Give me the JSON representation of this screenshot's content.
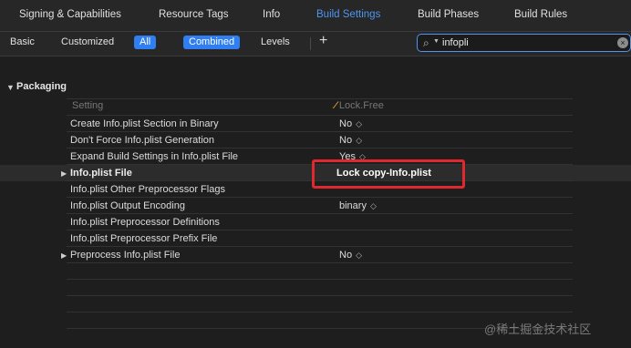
{
  "tabs": [
    {
      "label": "Signing & Capabilities",
      "active": false
    },
    {
      "label": "Resource Tags",
      "active": false
    },
    {
      "label": "Info",
      "active": false
    },
    {
      "label": "Build Settings",
      "active": true
    },
    {
      "label": "Build Phases",
      "active": false
    },
    {
      "label": "Build Rules",
      "active": false
    }
  ],
  "filters": {
    "basic": "Basic",
    "customized": "Customized",
    "all": "All",
    "combined": "Combined",
    "levels": "Levels",
    "add": "+"
  },
  "search": {
    "value": "infopli",
    "clear": "×"
  },
  "section": {
    "title": "Packaging",
    "header_setting": "Setting",
    "header_target": "Lock.Free",
    "target_icon": "⁄"
  },
  "rows": [
    {
      "name": "Create Info.plist Section in Binary",
      "value": "No",
      "stepper": "◇"
    },
    {
      "name": "Don't Force Info.plist Generation",
      "value": "No",
      "stepper": "◇"
    },
    {
      "name": "Expand Build Settings in Info.plist File",
      "value": "Yes",
      "stepper": "◇"
    },
    {
      "name": "Info.plist File",
      "value": "Lock copy-Info.plist",
      "stepper": ""
    },
    {
      "name": "Info.plist Other Preprocessor Flags",
      "value": "",
      "stepper": ""
    },
    {
      "name": "Info.plist Output Encoding",
      "value": "binary",
      "stepper": "◇"
    },
    {
      "name": "Info.plist Preprocessor Definitions",
      "value": "",
      "stepper": ""
    },
    {
      "name": "Info.plist Preprocessor Prefix File",
      "value": "",
      "stepper": ""
    },
    {
      "name": "Preprocess Info.plist File",
      "value": "No",
      "stepper": "◇"
    }
  ],
  "watermark": "@稀土掘金技术社区",
  "colors": {
    "accent": "#2f7ef2",
    "active_tab": "#4f95f0",
    "highlight": "#e0292e"
  }
}
